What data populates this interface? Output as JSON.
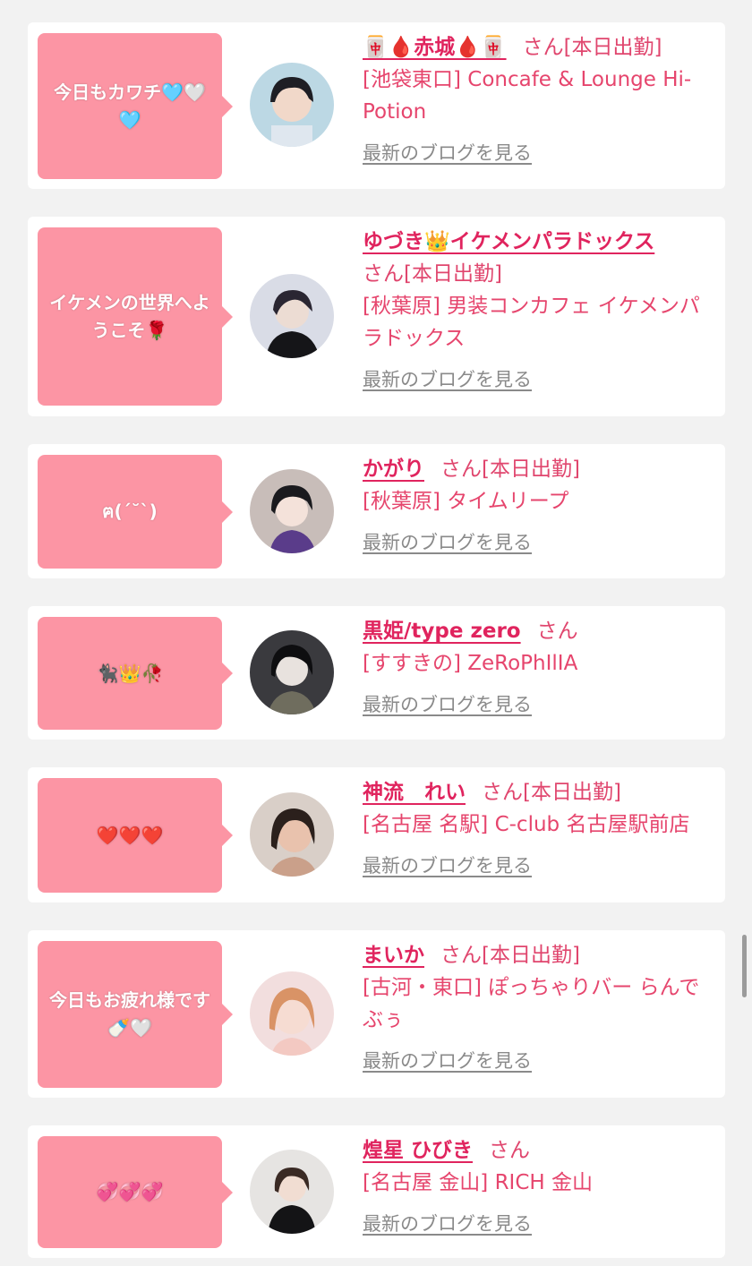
{
  "blog_link_label": "最新のブログを見る",
  "colors": {
    "bubble": "#fc95a4",
    "name": "#e0245e",
    "text": "#e6456d",
    "link": "#8a8a8a"
  },
  "entries": [
    {
      "bubble": "今日もカワチ🩵🤍🩵",
      "name": "🀄🩸赤城🩸🀄",
      "suffix": "さん[本日出勤]",
      "shop": "[池袋東口] Concafe & Lounge Hi-Potion"
    },
    {
      "bubble": "イケメンの世界へようこそ🌹",
      "name": "ゆづき👑イケメンパラドックス",
      "suffix": "さん[本日出勤]",
      "shop": "[秋葉原] 男装コンカフェ イケメンパラドックス"
    },
    {
      "bubble": "ฅ(ˊ˘ˋ)",
      "name": "かがり",
      "suffix": "さん[本日出勤]",
      "shop": "[秋葉原] タイムリープ"
    },
    {
      "bubble": "🐈‍⬛👑🥀",
      "name": "黒姫/type zero",
      "suffix": "さん",
      "shop": "[すすきの] ZeRoPhIlIA"
    },
    {
      "bubble": "❤️❤️❤️",
      "name": "神流　れい",
      "suffix": "さん[本日出勤]",
      "shop": "[名古屋 名駅] C-club 名古屋駅前店"
    },
    {
      "bubble": "今日もお疲れ様です🍼🤍",
      "name": "まいか",
      "suffix": "さん[本日出勤]",
      "shop": "[古河・東口] ぽっちゃりバー らんでぶぅ"
    },
    {
      "bubble": "💞💞💞",
      "name": "煌星 ひびき",
      "suffix": "さん",
      "shop": "[名古屋 金山] RICH 金山"
    }
  ]
}
